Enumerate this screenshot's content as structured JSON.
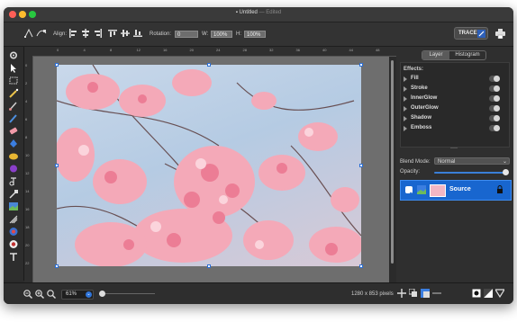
{
  "window": {
    "title": "Untitled",
    "edited": "Edited"
  },
  "toolbar": {
    "align_label": "Align:",
    "rotation_label": "Rotation:",
    "rotation_value": "0",
    "width_label": "W:",
    "width_value": "100%",
    "height_label": "H:",
    "height_value": "100%",
    "trace_label": "TRACE"
  },
  "rulers": {
    "top_ticks": [
      "0",
      "4",
      "8",
      "12",
      "16",
      "20",
      "24",
      "28",
      "32",
      "36",
      "40",
      "44",
      "48"
    ],
    "left_ticks": [
      "0",
      "2",
      "4",
      "6",
      "8",
      "10",
      "12",
      "14",
      "16",
      "18",
      "20",
      "22"
    ]
  },
  "panel": {
    "tabs": [
      "Layer",
      "Histogram"
    ],
    "active_tab": "Layer",
    "effects_label": "Effects:",
    "effects": [
      {
        "name": "Fill"
      },
      {
        "name": "Stroke"
      },
      {
        "name": "InnerGlow"
      },
      {
        "name": "OuterGlow"
      },
      {
        "name": "Shadow"
      },
      {
        "name": "Emboss"
      }
    ],
    "blend_mode_label": "Blend Mode:",
    "blend_mode_value": "Normal",
    "opacity_label": "Opacity:",
    "opacity_value": 1.0,
    "layer_name": "Source"
  },
  "status": {
    "zoom_value": "61%",
    "dimensions": "1280 x 853 pixels"
  },
  "colors": {
    "accent": "#1866cf",
    "selection_handle": "#2b6fd6"
  }
}
